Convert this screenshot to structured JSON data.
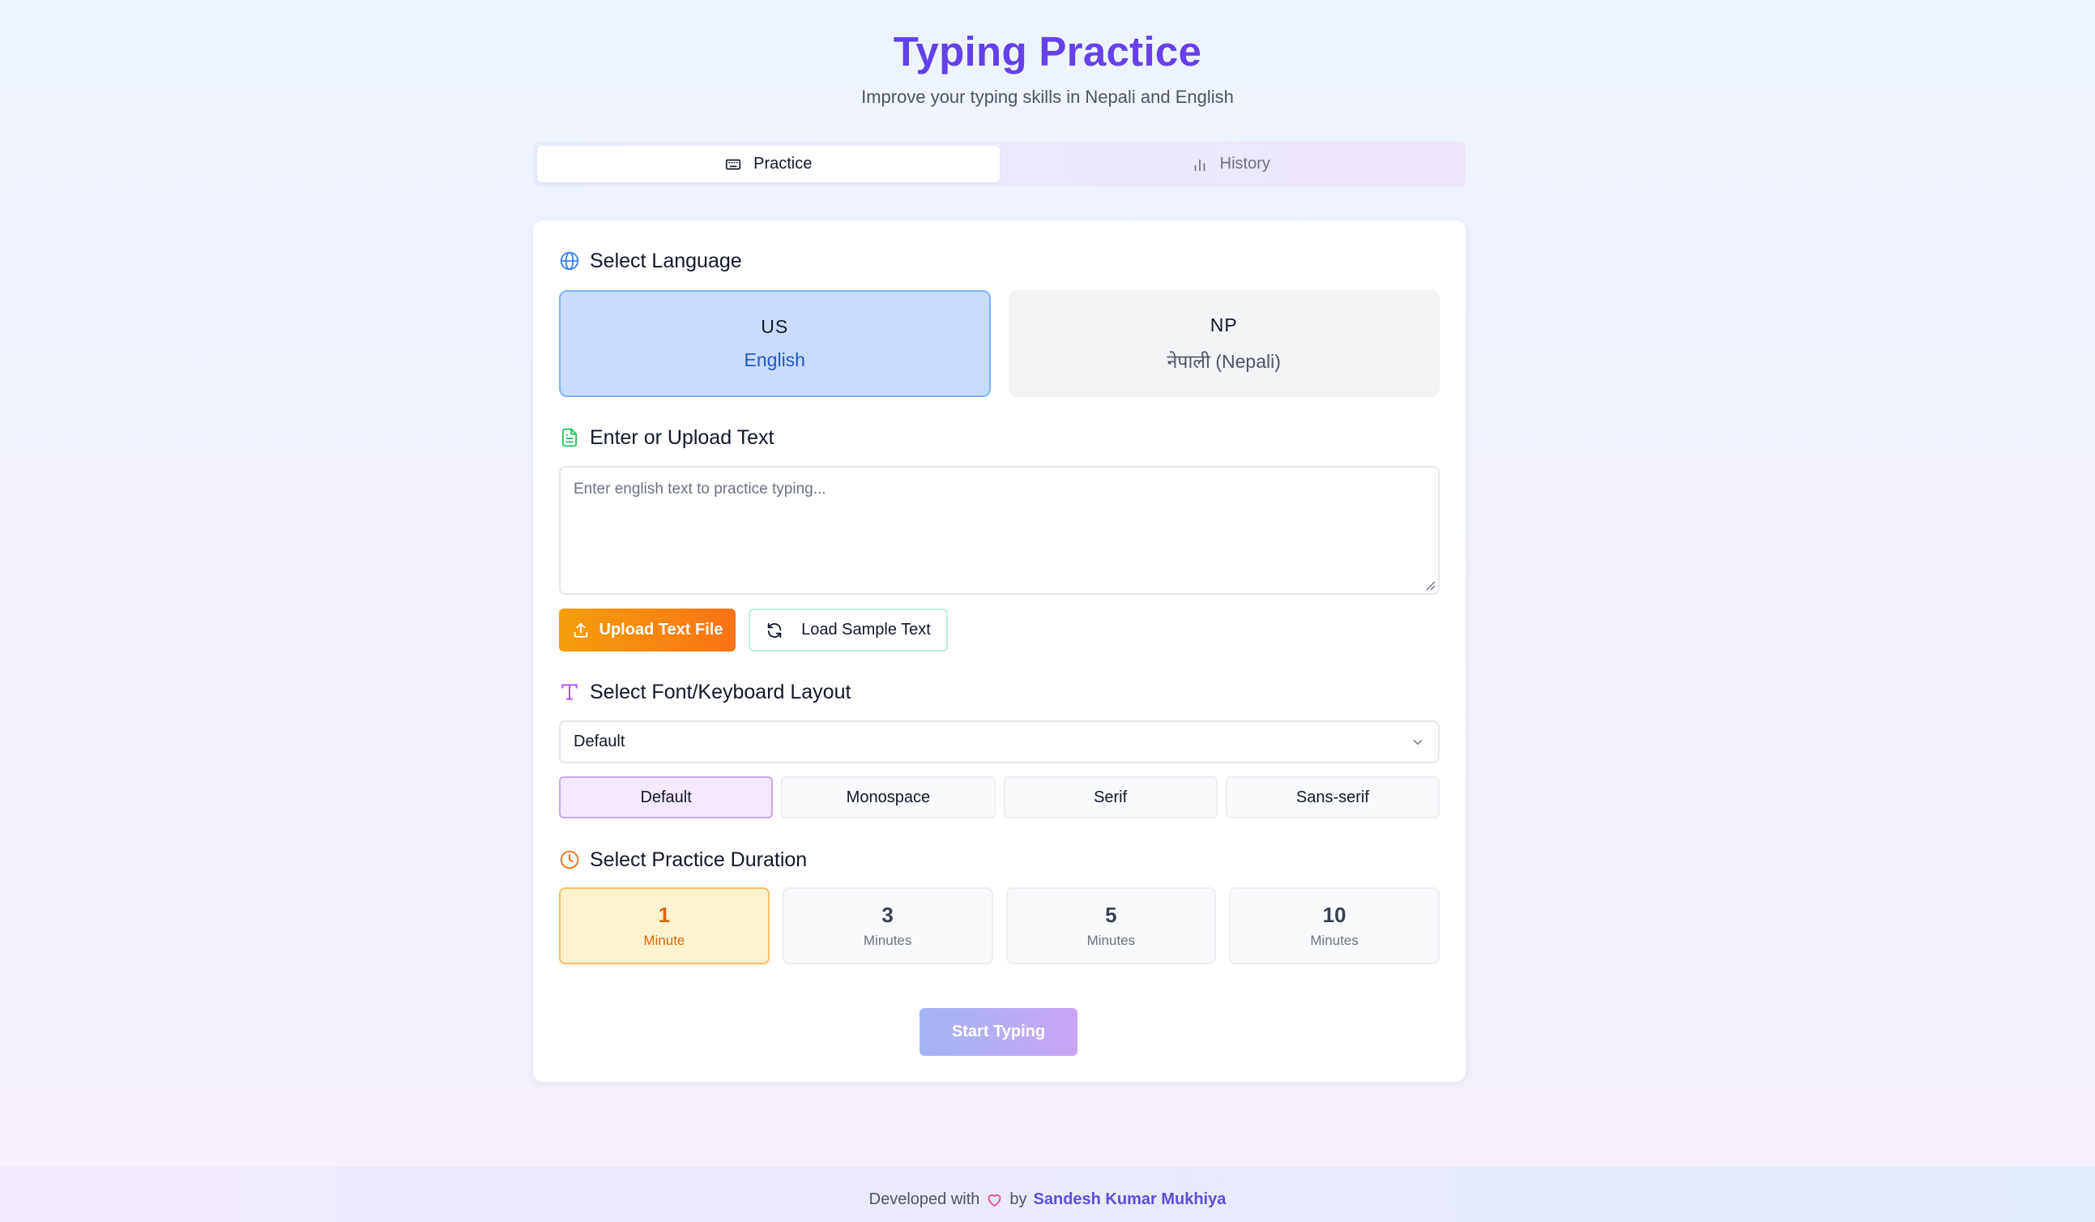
{
  "header": {
    "title": "Typing Practice",
    "subtitle": "Improve your typing skills in Nepali and English"
  },
  "tabs": [
    {
      "label": "Practice",
      "icon": "keyboard-icon",
      "active": true
    },
    {
      "label": "History",
      "icon": "bar-chart-icon",
      "active": false
    }
  ],
  "language": {
    "title": "Select Language",
    "options": [
      {
        "code": "US",
        "name": "English",
        "selected": true
      },
      {
        "code": "NP",
        "name": "नेपाली (Nepali)",
        "selected": false
      }
    ]
  },
  "text_input": {
    "title": "Enter or Upload Text",
    "placeholder": "Enter english text to practice typing...",
    "value": "",
    "upload_label": "Upload Text File",
    "sample_label": "Load Sample Text"
  },
  "font": {
    "title": "Select Font/Keyboard Layout",
    "selected_value": "Default",
    "options": [
      {
        "label": "Default",
        "selected": true
      },
      {
        "label": "Monospace",
        "selected": false
      },
      {
        "label": "Serif",
        "selected": false
      },
      {
        "label": "Sans-serif",
        "selected": false
      }
    ]
  },
  "duration": {
    "title": "Select Practice Duration",
    "options": [
      {
        "value": "1",
        "unit": "Minute",
        "selected": true
      },
      {
        "value": "3",
        "unit": "Minutes",
        "selected": false
      },
      {
        "value": "5",
        "unit": "Minutes",
        "selected": false
      },
      {
        "value": "10",
        "unit": "Minutes",
        "selected": false
      }
    ]
  },
  "start_label": "Start Typing",
  "footer": {
    "prefix": "Developed with",
    "middle": "by",
    "author": "Sandesh Kumar Mukhiya"
  },
  "colors": {
    "accent": "#5b4fe0",
    "language_selected": "#c8ddfd",
    "duration_selected": "#fff2cf",
    "upload_button": "#f97316"
  }
}
